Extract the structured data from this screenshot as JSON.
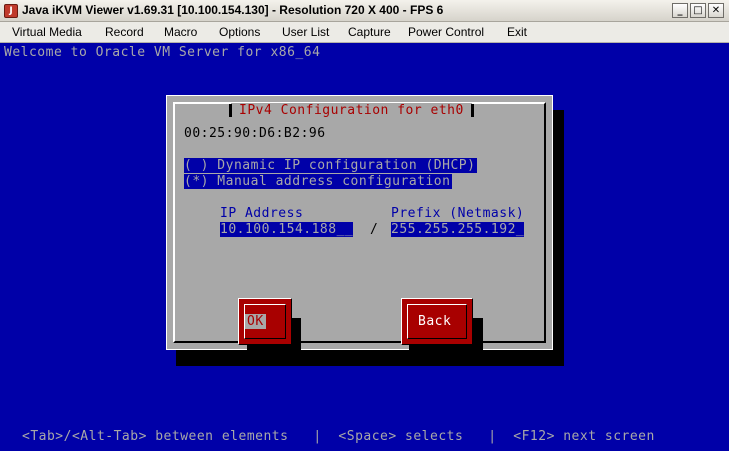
{
  "window": {
    "title": "Java iKVM Viewer v1.69.31 [10.100.154.130]  - Resolution 720 X 400 - FPS 6",
    "icon": "java-app-icon",
    "minimize": "_",
    "maximize": "□",
    "close": "✕"
  },
  "menu": {
    "items": [
      "Virtual Media",
      "Record",
      "Macro",
      "Options",
      "User List",
      "Capture",
      "Power Control",
      "Exit"
    ]
  },
  "console": {
    "welcome": "Welcome to Oracle VM Server for x86_64",
    "dialog": {
      "title": "IPv4 Configuration for eth0",
      "mac": "00:25:90:D6:B2:96",
      "option_dhcp": "( ) Dynamic IP configuration (DHCP)",
      "option_manual": "(*) Manual address configuration",
      "ip_label": "IP Address",
      "prefix_label": "Prefix (Netmask)",
      "ip_value": "10.100.154.188__",
      "separator": "/",
      "prefix_value": "255.255.255.192_",
      "ok_label": "OK",
      "back_label": "Back"
    },
    "footer": "<Tab>/<Alt-Tab> between elements   |  <Space> selects   |  <F12> next screen"
  },
  "colors": {
    "console_bg": "#0000A8",
    "dialog_bg": "#A8A8A8",
    "button_red": "#A80000"
  }
}
